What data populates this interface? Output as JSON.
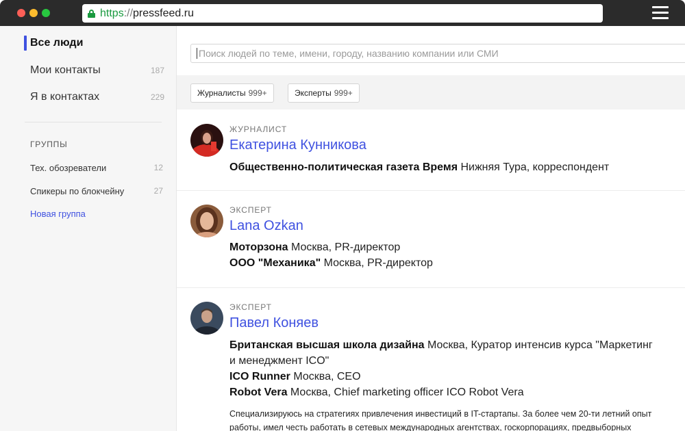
{
  "browser": {
    "url_scheme": "https",
    "url_sep": "://",
    "url_host": "pressfeed.ru"
  },
  "sidebar": {
    "nav": [
      {
        "label": "Все люди",
        "count": ""
      },
      {
        "label": "Мои контакты",
        "count": "187"
      },
      {
        "label": "Я в контактах",
        "count": "229"
      }
    ],
    "groups_title": "ГРУППЫ",
    "groups": [
      {
        "label": "Тех. обозреватели",
        "count": "12"
      },
      {
        "label": "Спикеры по блокчейну",
        "count": "27"
      }
    ],
    "new_group": "Новая группа"
  },
  "search": {
    "placeholder": "Поиск людей по теме, имени, городу, названию компании или СМИ"
  },
  "filters": [
    {
      "label": "Журналисты",
      "count": "999+"
    },
    {
      "label": "Эксперты",
      "count": "999+"
    }
  ],
  "people": [
    {
      "role": "ЖУРНАЛИСТ",
      "name": "Екатерина Кунникова",
      "jobs": [
        {
          "org": "Общественно-политическая газета Время",
          "detail": " Нижняя Тура, корреспондент"
        }
      ]
    },
    {
      "role": "ЭКСПЕРТ",
      "name": "Lana Ozkan",
      "jobs": [
        {
          "org": "Моторзона",
          "detail": " Москва, PR-директор"
        },
        {
          "org": "ООО \"Механика\"",
          "detail": " Москва, PR-директор"
        }
      ]
    },
    {
      "role": "ЭКСПЕРТ",
      "name": "Павел Коняев",
      "jobs": [
        {
          "org": "Британская высшая школа дизайна",
          "detail": " Москва, Куратор интенсив курса \"Маркетинг"
        },
        {
          "org": "",
          "detail": "и менеджмент ICO\""
        },
        {
          "org": "ICO Runner",
          "detail": " Москва, CEO"
        },
        {
          "org": "Robot Vera",
          "detail": " Москва, Chief marketing officer ICO Robot Vera"
        }
      ],
      "bio_1": "Специализируюсь на стратегиях привлечения инвестиций в IT-стартапы. За более чем 20-ти летний опыт",
      "bio_2": "работы, имел честь работать в сетевых международных агентствах, госкорпорациях, предвыборных"
    }
  ],
  "colors": {
    "accent": "#3f51e0",
    "secure": "#1a9a3f"
  }
}
